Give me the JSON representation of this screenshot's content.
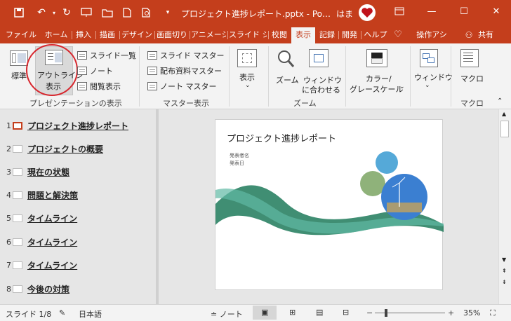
{
  "titlebar": {
    "title": "プロジェクト進捗レポート.pptx - Po…",
    "user": "はま",
    "ribbon_display_icon": "ribbon-display-icon",
    "minimize": "—",
    "restore": "☐",
    "close": "✕"
  },
  "tabs": [
    {
      "label": "ファイル"
    },
    {
      "label": "ホーム"
    },
    {
      "label": "挿入"
    },
    {
      "label": "描画"
    },
    {
      "label": "デザイン"
    },
    {
      "label": "画面切り"
    },
    {
      "label": "アニメーシ"
    },
    {
      "label": "スライド シ"
    },
    {
      "label": "校閲"
    },
    {
      "label": "表示"
    },
    {
      "label": "記録"
    },
    {
      "label": "開発"
    },
    {
      "label": "ヘルプ"
    },
    {
      "label": "操作アシ"
    },
    {
      "label": "共有"
    }
  ],
  "ribbon": {
    "normal": "標準",
    "outline_line1": "アウトライン",
    "outline_line2": "表示",
    "slide_sorter": "スライド一覧",
    "notes": "ノート",
    "reading": "閲覧表示",
    "group_presentation": "プレゼンテーションの表示",
    "slide_master": "スライド マスター",
    "handout_master": "配布資料マスター",
    "notes_master": "ノート マスター",
    "group_master": "マスター表示",
    "show": "表示",
    "zoom": "ズーム",
    "fit_line1": "ウィンドウ",
    "fit_line2": "に合わせる",
    "group_zoom": "ズーム",
    "color_line1": "カラー/",
    "color_line2": "グレースケール",
    "window": "ウィンドウ",
    "macro": "マクロ",
    "group_macro": "マクロ"
  },
  "outline": [
    {
      "num": "1",
      "text": "プロジェクト進捗レポート"
    },
    {
      "num": "2",
      "text": "プロジェクトの概要"
    },
    {
      "num": "3",
      "text": "現在の状態"
    },
    {
      "num": "4",
      "text": "問題と解決策"
    },
    {
      "num": "5",
      "text": "タイムライン"
    },
    {
      "num": "6",
      "text": "タイムライン"
    },
    {
      "num": "7",
      "text": "タイムライン"
    },
    {
      "num": "8",
      "text": "今後の対策"
    }
  ],
  "slide": {
    "title": "プロジェクト進捗レポート",
    "presenter": "発表者名",
    "date": "発表日"
  },
  "status": {
    "slide_count": "スライド 1/8",
    "language": "日本語",
    "notes": "ノート",
    "zoom": "35%"
  },
  "colors": {
    "accent": "#c43e1c"
  }
}
